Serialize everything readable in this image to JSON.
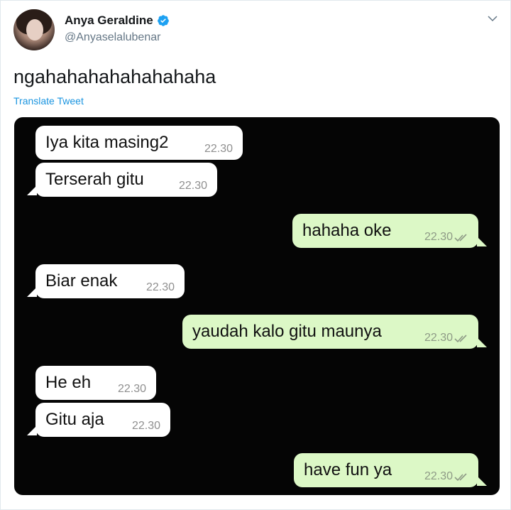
{
  "user": {
    "name": "Anya Geraldine",
    "handle": "@Anyaselalubenar",
    "verified": true
  },
  "tweet": {
    "text": "ngahahahahahahahaha",
    "translate_label": "Translate Tweet"
  },
  "chat": {
    "messages": [
      {
        "text": "Iya kita masing2",
        "time": "22.30",
        "side": "incoming"
      },
      {
        "text": "Terserah gitu",
        "time": "22.30",
        "side": "incoming"
      },
      {
        "text": "hahaha oke",
        "time": "22.30",
        "side": "outgoing"
      },
      {
        "text": "Biar enak",
        "time": "22.30",
        "side": "incoming"
      },
      {
        "text": "yaudah kalo gitu maunya",
        "time": "22.30",
        "side": "outgoing"
      },
      {
        "text": "He eh",
        "time": "22.30",
        "side": "incoming"
      },
      {
        "text": "Gitu aja",
        "time": "22.30",
        "side": "incoming"
      },
      {
        "text": "have fun ya",
        "time": "22.30",
        "side": "outgoing"
      }
    ]
  },
  "colors": {
    "accent": "#1b95e0",
    "verified_badge": "#1da1f2",
    "incoming_bubble": "#ffffff",
    "outgoing_bubble": "#dcf8c6",
    "chat_background": "#050505"
  }
}
